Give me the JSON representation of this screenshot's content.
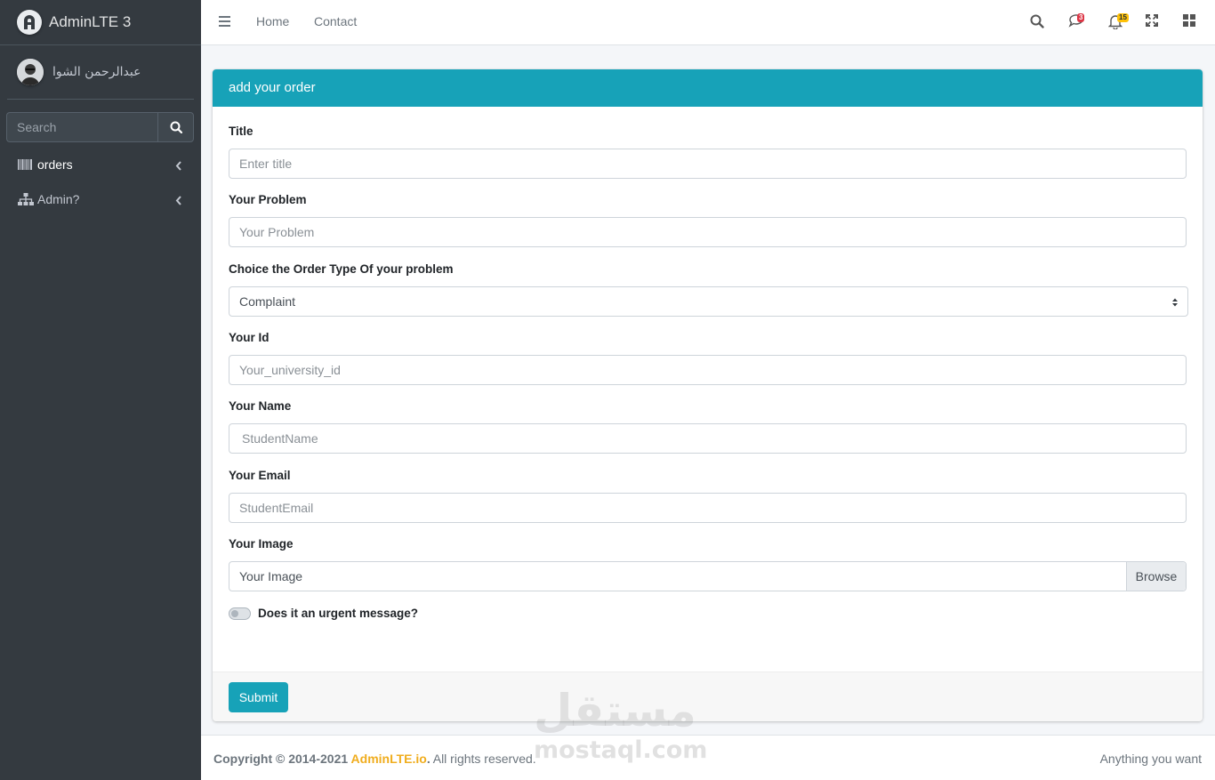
{
  "sidebar": {
    "brand": "AdminLTE 3",
    "user_name": "عبدالرحمن الشوا",
    "search_placeholder": "Search",
    "items": [
      {
        "label": "orders",
        "icon": "barcode-icon"
      },
      {
        "label": "Admin?",
        "icon": "sitemap-icon"
      }
    ]
  },
  "navbar": {
    "links": [
      "Home",
      "Contact"
    ],
    "messages_count": "3",
    "notifications_count": "15"
  },
  "card": {
    "title": "add your order",
    "fields": {
      "title_label": "Title",
      "title_placeholder": "Enter title",
      "problem_label": "Your Problem",
      "problem_placeholder": "Your Problem",
      "type_label": "Choice the Order Type Of your problem",
      "type_value": "Complaint",
      "id_label": "Your Id",
      "id_placeholder": "Your_university_id",
      "name_label": "Your Name",
      "name_placeholder": "StudentName",
      "email_label": "Your Email",
      "email_placeholder": "StudentEmail",
      "image_label": "Your Image",
      "image_text": "Your Image",
      "browse_label": "Browse",
      "urgent_label": "Does it an urgent message?",
      "urgent_checked": false
    },
    "submit_label": "Submit"
  },
  "footer": {
    "copyright_prefix": "Copyright © 2014-2021 ",
    "brand_link": "AdminLTE.io",
    "copyright_suffix": ". All rights reserved.",
    "right_text": "Anything you want"
  },
  "watermark": {
    "arabic": "مستقل",
    "latin": "mostaql.com"
  },
  "colors": {
    "sidebar_bg": "#343a40",
    "accent": "#17a2b8",
    "badge_danger": "#dc3545",
    "badge_warning": "#ffc107",
    "brand_link": "#f0ad1e"
  }
}
